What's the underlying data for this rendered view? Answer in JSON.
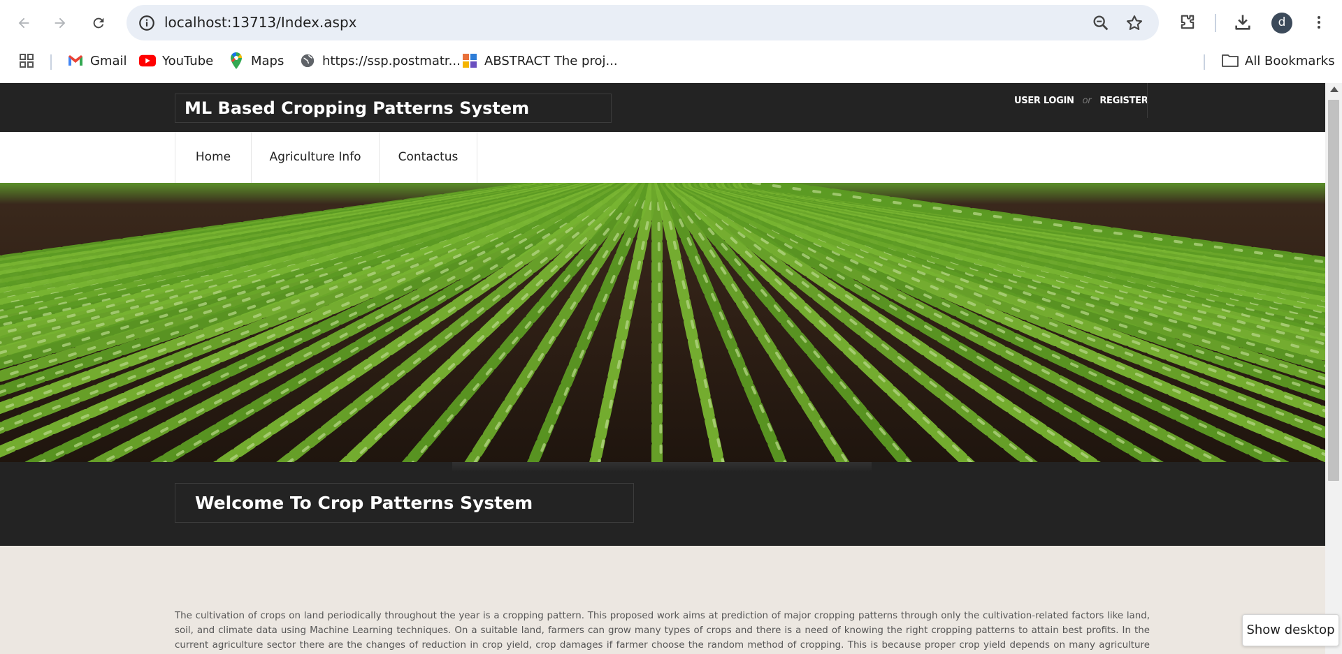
{
  "browser": {
    "url": "localhost:13713/Index.aspx",
    "avatar_letter": "d",
    "bookmarks": [
      {
        "label": "Gmail",
        "icon": "gmail-icon"
      },
      {
        "label": "YouTube",
        "icon": "youtube-icon"
      },
      {
        "label": "Maps",
        "icon": "maps-icon"
      },
      {
        "label": "https://ssp.postmatr...",
        "icon": "globe-icon"
      },
      {
        "label": "ABSTRACT The proj...",
        "icon": "document-icon"
      }
    ],
    "all_bookmarks_label": "All Bookmarks"
  },
  "site": {
    "title": "ML Based Cropping Patterns System",
    "user_login_label": "USER LOGIN",
    "or_label": "or",
    "register_label": "REGISTER",
    "menu": [
      {
        "label": "Home"
      },
      {
        "label": "Agriculture Info"
      },
      {
        "label": "Contactus"
      }
    ],
    "welcome_heading": "Welcome To Crop Patterns System",
    "intro_paragraph": "The cultivation of crops on land periodically throughout the year is a cropping pattern. This proposed work aims at prediction of major cropping patterns through only the cultivation-related factors like land, soil, and climate data using Machine Learning techniques. On a suitable land, farmers can grow many types of crops and there is a need of knowing the right cropping patterns to attain best profits. In the current agriculture sector there are the changes of reduction in crop yield, crop damages if farmer choose the random method of cropping. This is because proper crop yield depends on many agriculture parameters like temperature,"
  },
  "taskbar": {
    "show_desktop_label": "Show desktop"
  },
  "colors": {
    "header_dark": "#232323",
    "page_bg": "#ece7e1",
    "omnibox_bg": "#e9eef6"
  }
}
